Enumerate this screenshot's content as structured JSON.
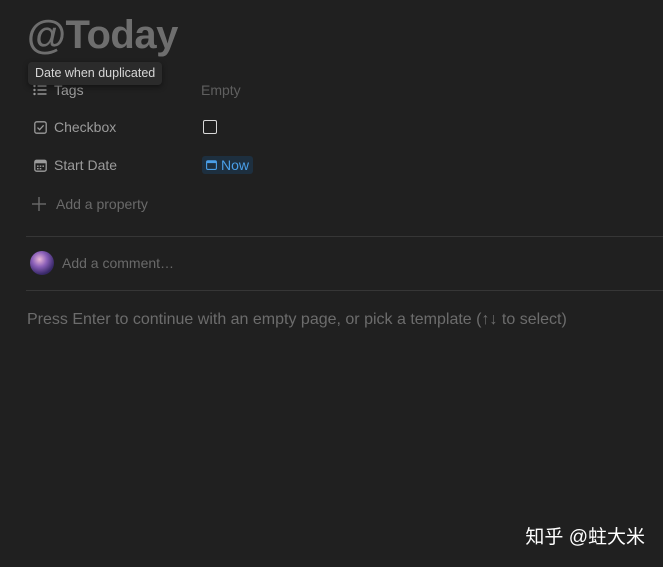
{
  "page": {
    "title": "@Today",
    "tooltip": "Date when duplicated"
  },
  "properties": [
    {
      "name": "Tags",
      "icon": "list-icon",
      "value": "Empty"
    },
    {
      "name": "Checkbox",
      "icon": "checkbox-icon",
      "checked": false
    },
    {
      "name": "Start Date",
      "icon": "calendar-icon",
      "value": "Now"
    }
  ],
  "add_property_label": "Add a property",
  "comment": {
    "placeholder": "Add a comment…"
  },
  "hint": "Press Enter to continue with an empty page, or pick a template (↑↓ to select)",
  "watermark": "知乎 @蛀大米",
  "colors": {
    "background": "#202020",
    "title": "#6e6e6e",
    "date_chip_bg": "#1d2f3f",
    "date_chip_text": "#4a9fe8"
  }
}
